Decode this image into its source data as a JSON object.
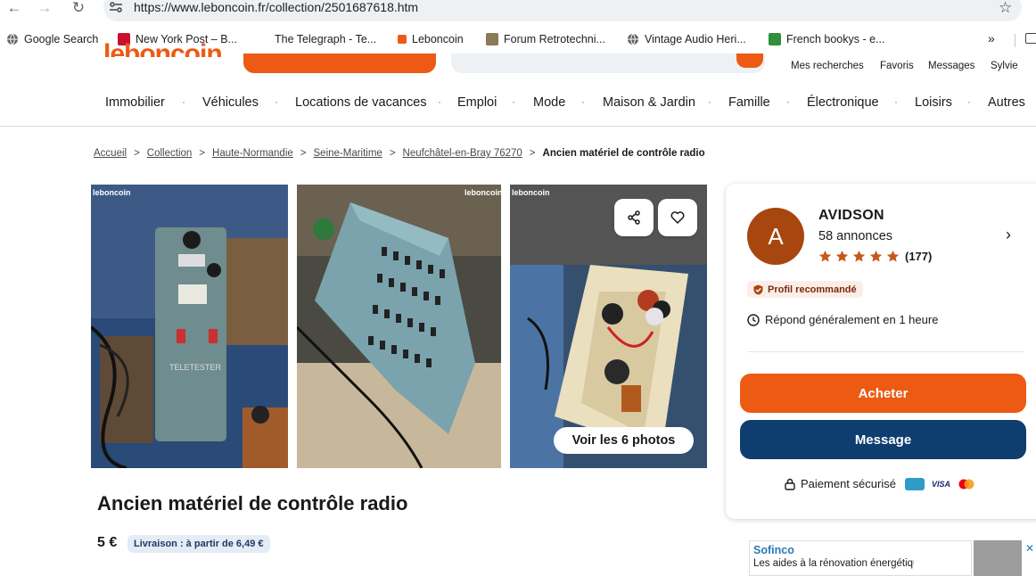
{
  "browser": {
    "url": "https://www.leboncoin.fr/collection/2501687618.htm",
    "bookmarks": [
      {
        "label": "Google Search",
        "icon": "globe-icon"
      },
      {
        "label": "New York Post – B...",
        "icon": "nypost-icon"
      },
      {
        "label": "The Telegraph - Te...",
        "icon": "telegraph-icon"
      },
      {
        "label": "Leboncoin",
        "icon": "leboncoin-icon"
      },
      {
        "label": "Forum Retrotechni...",
        "icon": "forum-icon"
      },
      {
        "label": "Vintage Audio Heri...",
        "icon": "globe-icon"
      },
      {
        "label": "French bookys - e...",
        "icon": "book-icon"
      }
    ],
    "more": "»"
  },
  "header": {
    "logo": "leboncoin",
    "user_links": [
      "Mes recherches",
      "Favoris",
      "Messages",
      "Sylvie"
    ],
    "categories": [
      "Immobilier",
      "Véhicules",
      "Locations de vacances",
      "Emploi",
      "Mode",
      "Maison & Jardin",
      "Famille",
      "Électronique",
      "Loisirs",
      "Autres"
    ]
  },
  "breadcrumb": {
    "items": [
      "Accueil",
      "Collection",
      "Haute-Normandie",
      "Seine-Maritime",
      "Neufchâtel-en-Bray 76270"
    ],
    "current": "Ancien matériel de contrôle radio"
  },
  "gallery": {
    "watermark": "leboncoin",
    "view_all_label": "Voir les 6 photos"
  },
  "listing": {
    "title": "Ancien matériel de contrôle radio",
    "price": "5 €",
    "delivery": "Livraison : à partir de 6,49 €"
  },
  "seller": {
    "initial": "A",
    "name": "AVIDSON",
    "ads_count": "58 annonces",
    "rating_stars": 5,
    "rating_count": "(177)",
    "badge": "Profil recommandé",
    "response": "Répond généralement en 1 heure",
    "buy_label": "Acheter",
    "message_label": "Message",
    "secure_label": "Paiement sécurisé",
    "payment_logos": [
      "CB",
      "VISA",
      "Mastercard"
    ]
  },
  "ad": {
    "title": "Sofinco",
    "text": "Les aides à la rénovation énergétique"
  },
  "colors": {
    "brand_orange": "#ec5a13",
    "navy": "#0e3d70",
    "avatar_brown": "#a8460f"
  }
}
